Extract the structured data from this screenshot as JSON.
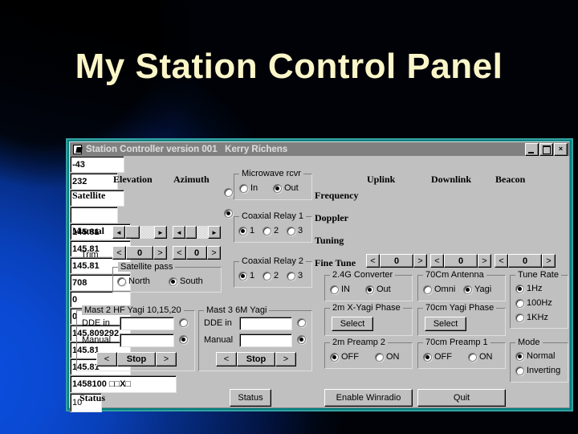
{
  "slide": {
    "title": "My Station Control Panel",
    "title_color": "#FAF6C8",
    "bg_color": "#0b50e0"
  },
  "window": {
    "title": "Station Controller version 001   Kerry Richens",
    "icon": "app-window-icon",
    "buttons": {
      "minimize": "_",
      "maximize": "□",
      "close": "×"
    }
  },
  "rotator": {
    "col_headers": {
      "elevation": "Elevation",
      "azimuth": "Azimuth"
    },
    "row_labels": {
      "satellite": "Satellite",
      "manual": "Manual",
      "trim": "Trim"
    },
    "satellite": {
      "elevation": "-43",
      "azimuth": "232"
    },
    "manual": {
      "elevation": "",
      "azimuth": ""
    },
    "trim": {
      "elevation": "0",
      "azimuth": "0"
    },
    "source_radios": {
      "satellite_selected": false,
      "manual_selected": true
    },
    "spin_left": "<",
    "spin_right": ">",
    "scroll_left": "◄",
    "scroll_right": "►"
  },
  "satellite_pass": {
    "title": "Satellite pass",
    "options": [
      {
        "label": "North",
        "selected": false
      },
      {
        "label": "South",
        "selected": true
      }
    ]
  },
  "microwave_rcvr": {
    "title": "Microwave rcvr",
    "options": [
      {
        "label": "In",
        "selected": false
      },
      {
        "label": "Out",
        "selected": true
      }
    ]
  },
  "coaxial_relay_1": {
    "title": "Coaxial Relay 1",
    "options": [
      {
        "label": "1",
        "selected": true
      },
      {
        "label": "2",
        "selected": false
      },
      {
        "label": "3",
        "selected": false
      }
    ]
  },
  "coaxial_relay_2": {
    "title": "Coaxial Relay 2",
    "options": [
      {
        "label": "1",
        "selected": true
      },
      {
        "label": "2",
        "selected": false
      },
      {
        "label": "3",
        "selected": false
      }
    ]
  },
  "frequency_panel": {
    "columns": [
      "Uplink",
      "Downlink",
      "Beacon"
    ],
    "rows": [
      {
        "label": "Frequency",
        "values": [
          "145.81",
          "145.81",
          "145.81"
        ]
      },
      {
        "label": "Doppler",
        "values": [
          "708",
          "0",
          "0"
        ]
      },
      {
        "label": "Tuning",
        "values": [
          "145.809292",
          "145.81",
          "145.81"
        ]
      }
    ],
    "fine_tune": {
      "label": "Fine Tune",
      "values": [
        "0",
        "0",
        "0"
      ],
      "left": "<",
      "right": ">"
    }
  },
  "converter_24g": {
    "title": "2.4G Converter",
    "options": [
      {
        "label": "IN",
        "selected": false
      },
      {
        "label": "Out",
        "selected": true
      }
    ]
  },
  "antenna_70cm": {
    "title": "70Cm Antenna",
    "options": [
      {
        "label": "Omni",
        "selected": false
      },
      {
        "label": "Yagi",
        "selected": true
      }
    ]
  },
  "phase_2m": {
    "title": "2m X-Yagi Phase",
    "button": "Select"
  },
  "phase_70cm": {
    "title": "70cm Yagi Phase",
    "button": "Select"
  },
  "preamp_2m": {
    "title": "2m Preamp 2",
    "options": [
      {
        "label": "OFF",
        "selected": true
      },
      {
        "label": "ON",
        "selected": false
      }
    ]
  },
  "preamp_70cm": {
    "title": "70cm Preamp 1",
    "options": [
      {
        "label": "OFF",
        "selected": true
      },
      {
        "label": "ON",
        "selected": false
      }
    ]
  },
  "tune_rate": {
    "title": "Tune Rate",
    "options": [
      {
        "label": "1Hz",
        "selected": true
      },
      {
        "label": "100Hz",
        "selected": false
      },
      {
        "label": "1KHz",
        "selected": false
      }
    ]
  },
  "mode": {
    "title": "Mode",
    "options": [
      {
        "label": "Normal",
        "selected": true
      },
      {
        "label": "Inverting",
        "selected": false
      }
    ]
  },
  "mast2": {
    "title": "Mast 2 HF Yagi 10,15,20",
    "dde_label": "DDE in",
    "dde_value": "",
    "dde_selected": false,
    "manual_label": "Manual",
    "manual_value": "",
    "manual_selected": true,
    "left": "<",
    "stop": "Stop",
    "right": ">"
  },
  "mast3": {
    "title": "Mast 3  6M Yagi",
    "dde_label": "DDE in",
    "dde_value": "",
    "dde_selected": false,
    "manual_label": "Manual",
    "manual_value": "",
    "manual_selected": true,
    "left": "<",
    "stop": "Stop",
    "right": ">"
  },
  "status_bar": {
    "label": "Status",
    "value": "1458100 □□X□",
    "status_button": "Status",
    "count_value": "10",
    "enable_winradio_button": "Enable Winradio",
    "quit_button": "Quit"
  }
}
